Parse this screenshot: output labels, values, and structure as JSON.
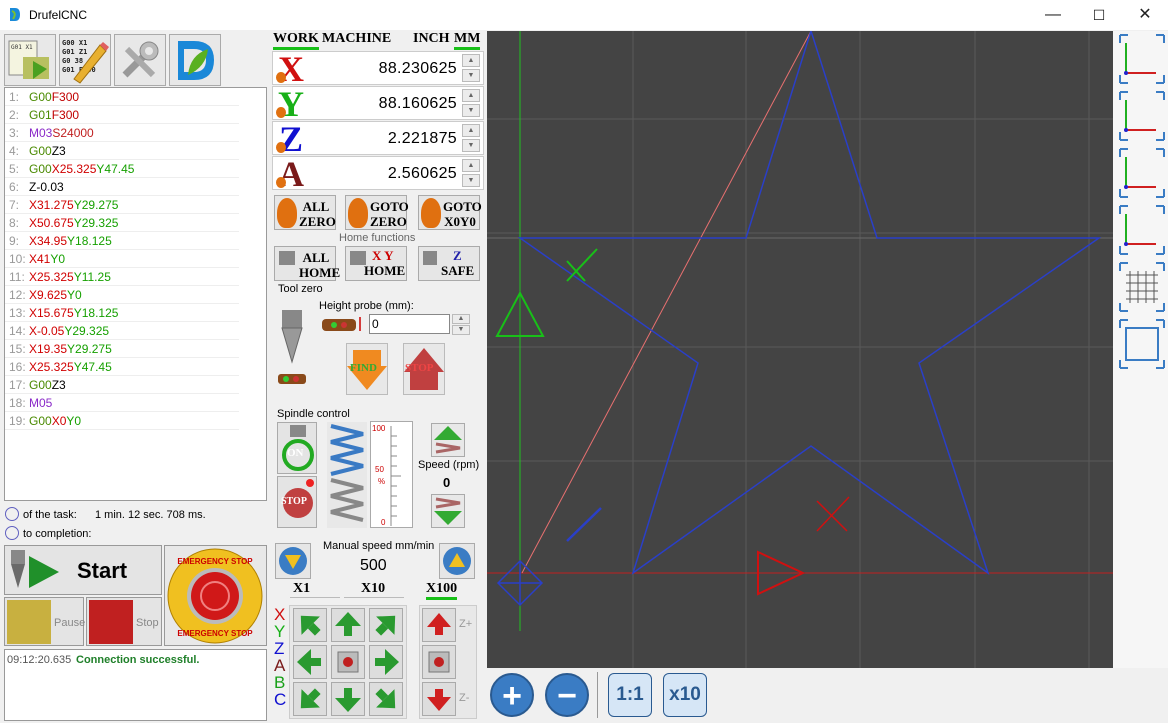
{
  "window": {
    "title": "DrufelCNC",
    "minimize": "—",
    "maximize": "☐",
    "close": "✕"
  },
  "toolbar": [
    {
      "name": "open-file-button"
    },
    {
      "name": "gcode-editor-button"
    },
    {
      "name": "settings-button"
    },
    {
      "name": "drufel-logo-button"
    }
  ],
  "code_lines": [
    {
      "n": "1:",
      "parts": [
        [
          "g",
          "G00"
        ],
        [
          "f",
          "F300"
        ]
      ]
    },
    {
      "n": "2:",
      "parts": [
        [
          "g",
          "G01"
        ],
        [
          "f",
          "F300"
        ]
      ]
    },
    {
      "n": "3:",
      "parts": [
        [
          "m",
          "M03"
        ],
        [
          "s",
          "S24000"
        ]
      ]
    },
    {
      "n": "4:",
      "parts": [
        [
          "g",
          "G00"
        ],
        [
          "zz",
          "Z3"
        ]
      ]
    },
    {
      "n": "5:",
      "parts": [
        [
          "g",
          "G00"
        ],
        [
          "xx",
          "X25.325"
        ],
        [
          "yy",
          "Y47.45"
        ]
      ]
    },
    {
      "n": "6:",
      "parts": [
        [
          "zz",
          "Z-0.03"
        ]
      ]
    },
    {
      "n": "7:",
      "parts": [
        [
          "xx",
          "X31.275"
        ],
        [
          "yy",
          "Y29.275"
        ]
      ]
    },
    {
      "n": "8:",
      "parts": [
        [
          "xx",
          "X50.675"
        ],
        [
          "yy",
          "Y29.325"
        ]
      ]
    },
    {
      "n": "9:",
      "parts": [
        [
          "xx",
          "X34.95"
        ],
        [
          "yy",
          "Y18.125"
        ]
      ]
    },
    {
      "n": "10:",
      "parts": [
        [
          "xx",
          "X41"
        ],
        [
          "yy",
          "Y0"
        ]
      ]
    },
    {
      "n": "11:",
      "parts": [
        [
          "xx",
          "X25.325"
        ],
        [
          "yy",
          "Y11.25"
        ]
      ]
    },
    {
      "n": "12:",
      "parts": [
        [
          "xx",
          "X9.625"
        ],
        [
          "yy",
          "Y0"
        ]
      ]
    },
    {
      "n": "13:",
      "parts": [
        [
          "xx",
          "X15.675"
        ],
        [
          "yy",
          "Y18.125"
        ]
      ]
    },
    {
      "n": "14:",
      "parts": [
        [
          "xx",
          "X-0.05"
        ],
        [
          "yy",
          "Y29.325"
        ]
      ]
    },
    {
      "n": "15:",
      "parts": [
        [
          "xx",
          "X19.35"
        ],
        [
          "yy",
          "Y29.275"
        ]
      ]
    },
    {
      "n": "16:",
      "parts": [
        [
          "xx",
          "X25.325"
        ],
        [
          "yy",
          "Y47.45"
        ]
      ]
    },
    {
      "n": "17:",
      "parts": [
        [
          "g",
          "G00"
        ],
        [
          "zz",
          "Z3"
        ]
      ]
    },
    {
      "n": "18:",
      "parts": [
        [
          "m",
          "M05"
        ]
      ]
    },
    {
      "n": "19:",
      "parts": [
        [
          "g",
          "G00"
        ],
        [
          "xx",
          "X0"
        ],
        [
          "yy",
          "Y0"
        ]
      ]
    }
  ],
  "task": {
    "time_label": "of the task:",
    "time_value": "1 min.  12 sec.  708 ms.",
    "completion_label": "to completion:"
  },
  "controls": {
    "start": "Start",
    "pause": "Pause",
    "stop": "Stop"
  },
  "emergency": {
    "top": "EMERGENCY STOP",
    "bottom": "EMERGENCY STOP"
  },
  "log": {
    "time": "09:12:20.635",
    "message": "Connection successful."
  },
  "coord_tabs": {
    "work": "WORK",
    "machine": "MACHINE",
    "inch": "INCH",
    "mm": "MM"
  },
  "axes": [
    {
      "letter": "X",
      "value": "88.230625",
      "color": "#d01010"
    },
    {
      "letter": "Y",
      "value": "88.160625",
      "color": "#18b018"
    },
    {
      "letter": "Z",
      "value": "2.221875",
      "color": "#1010d0"
    },
    {
      "letter": "A",
      "value": "2.560625",
      "color": "#7a1a1a"
    }
  ],
  "zero_buttons": {
    "all_zero": "ALL\nZERO",
    "goto_zero": "GOTO\nZERO",
    "goto_x0y0": "GOTO\nX0Y0"
  },
  "home": {
    "title": "Home functions",
    "all_home": "ALL\nHOME",
    "xy_home_top": "X Y",
    "xy_home_bottom": "HOME",
    "z_safe_top": "Z",
    "z_safe_bottom": "SAFE"
  },
  "tool_zero": {
    "title": "Tool zero",
    "probe_label": "Height probe (mm):",
    "probe_value": "0",
    "find": "FIND",
    "stop": "STOP"
  },
  "spindle": {
    "title": "Spindle control",
    "on": "ON",
    "stop": "STOP",
    "scale_top": "100",
    "scale_mid": "50",
    "scale_pct": "%",
    "scale_bot": "0",
    "speed_label": "Speed (rpm)",
    "speed_value": "0"
  },
  "jog": {
    "label": "Manual speed mm/min",
    "value": "500",
    "x1": "X1",
    "x10": "X10",
    "x100": "X100",
    "axes_letters": [
      "X",
      "Y",
      "Z",
      "A",
      "B",
      "C"
    ],
    "zplus": "Z+",
    "zminus": "Z-"
  },
  "view_buttons": {
    "zoom_in": "+",
    "zoom_out": "−",
    "one_to_one": "1:1",
    "x10": "x10"
  },
  "right_views": [
    {
      "name": "view-xy-button"
    },
    {
      "name": "view-xz-button"
    },
    {
      "name": "view-yz-button"
    },
    {
      "name": "view-3d-button"
    },
    {
      "name": "grid-toggle-button"
    },
    {
      "name": "frame-toggle-button"
    }
  ],
  "colors": {
    "canvas": "#444444",
    "toolpath": "#2a3fc8",
    "rapid": "#e06060",
    "green": "#18c818",
    "red": "#d01010"
  }
}
